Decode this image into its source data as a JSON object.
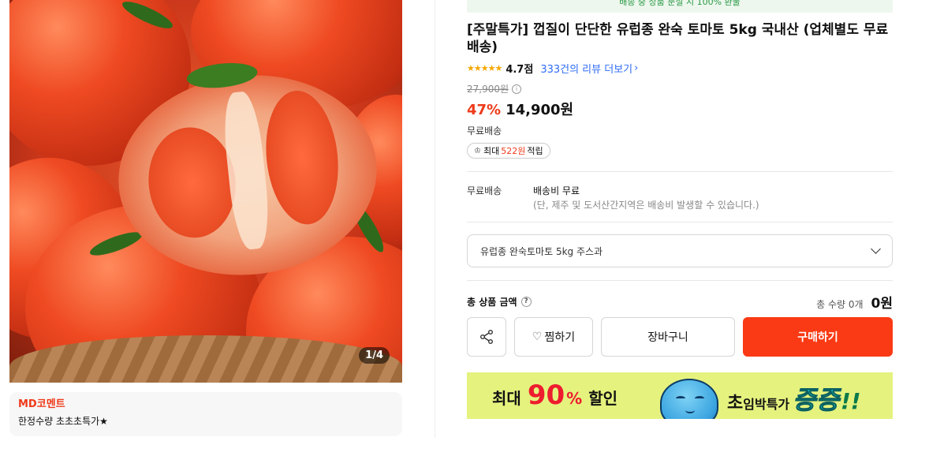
{
  "gallery": {
    "page_indicator": "1/4",
    "md_comment": {
      "title": "MD코멘트",
      "text": "한정수량 초초초특가★"
    }
  },
  "top_banner": {
    "text": "배송 중 상품 분실 시 100% 환불",
    "color": "#2a9a45"
  },
  "product": {
    "title": "[주말특가] 껍질이 단단한 유럽종 완숙 토마토 5kg 국내산 (업체별도 무료배송)",
    "rating": {
      "stars": 5,
      "score": "4.7점",
      "review_link": "333건의 리뷰 더보기"
    },
    "original_price": "27,900원",
    "discount_rate": "47%",
    "price": "14,900원",
    "shipping_summary": "무료배송",
    "points": {
      "prefix": "최대",
      "amount": "522원",
      "suffix": "적립"
    }
  },
  "shipping": {
    "label": "무료배송",
    "fee": "배송비 무료",
    "note": "(단, 제주 및 도서산간지역은 배송비 발생할 수 있습니다.)"
  },
  "option_select": {
    "selected": "유럽종 완숙토마토 5kg 주스과"
  },
  "total": {
    "label": "총 상품 금액",
    "help": "?",
    "quantity": "총 수량 0개",
    "amount": "0원"
  },
  "actions": {
    "wishlist": "찜하기",
    "cart": "장바구니",
    "buy": "구매하기"
  },
  "promo_banner": {
    "pre": "최대",
    "number": "90",
    "percent": "%",
    "post": "할인",
    "right_cho": "초",
    "right_small": "임박특가",
    "right_big": "증증",
    "right_bang": "!!"
  },
  "colors": {
    "accent": "#ee3a1a",
    "buy_button": "#fa3a14",
    "link": "#2f6df6",
    "star": "#f5a700"
  }
}
